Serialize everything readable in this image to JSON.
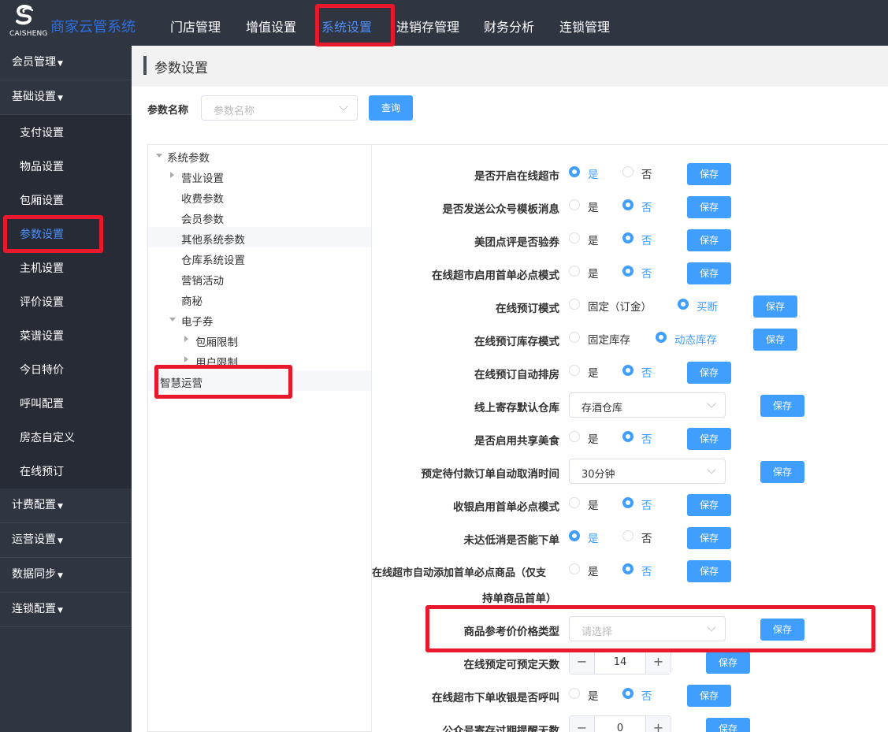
{
  "header": {
    "logo_text": "CAISHENG",
    "brand": "商家云管系统",
    "nav": [
      "门店管理",
      "增值设置",
      "系统设置",
      "进销存管理",
      "财务分析",
      "连锁管理"
    ],
    "active_nav": "系统设置"
  },
  "sidebar": {
    "groups_top": [
      {
        "label": "会员管理"
      },
      {
        "label": "基础设置"
      }
    ],
    "items": [
      "支付设置",
      "物品设置",
      "包厢设置",
      "参数设置",
      "主机设置",
      "评价设置",
      "菜谱设置",
      "今日特价",
      "呼叫配置",
      "房态自定义",
      "在线预订"
    ],
    "active_item": "参数设置",
    "groups_bottom": [
      {
        "label": "计费配置"
      },
      {
        "label": "运营设置"
      },
      {
        "label": "数据同步"
      },
      {
        "label": "连锁配置"
      }
    ]
  },
  "page": {
    "title": "参数设置",
    "filter_label": "参数名称",
    "filter_placeholder": "参数名称",
    "query_button": "查询"
  },
  "tree": {
    "root": "系统参数",
    "nodes": [
      "营业设置",
      "收费参数",
      "会员参数",
      "其他系统参数",
      "仓库系统设置",
      "营销活动",
      "商秘",
      "电子券",
      "包厢限制",
      "用户限制",
      "智慧运营"
    ],
    "selected": "其他系统参数"
  },
  "form": {
    "save_label": "保存",
    "rows": [
      {
        "label": "是否开启在线超市",
        "options": [
          "是",
          "否"
        ],
        "selected": 0
      },
      {
        "label": "是否发送公众号模板消息",
        "options": [
          "是",
          "否"
        ],
        "selected": 1
      },
      {
        "label": "美团点评是否验券",
        "options": [
          "是",
          "否"
        ],
        "selected": 1
      },
      {
        "label": "在线超市启用首单必点模式",
        "options": [
          "是",
          "否"
        ],
        "selected": 1
      },
      {
        "label": "在线预订模式",
        "options": [
          "固定（订金）",
          "买断"
        ],
        "selected": 1
      },
      {
        "label": "在线预订库存模式",
        "options": [
          "固定库存",
          "动态库存"
        ],
        "selected": 1
      },
      {
        "label": "在线预订自动排房",
        "options": [
          "是",
          "否"
        ],
        "selected": 1
      },
      {
        "label": "线上寄存默认仓库",
        "select_value": "存酒仓库"
      },
      {
        "label": "是否启用共享美食",
        "options": [
          "是",
          "否"
        ],
        "selected": 1
      },
      {
        "label": "预定待付款订单自动取消时间",
        "select_value": "30分钟"
      },
      {
        "label": "收银启用首单必点模式",
        "options": [
          "是",
          "否"
        ],
        "selected": 1
      },
      {
        "label": "未达低消是否能下单",
        "options": [
          "是",
          "否"
        ],
        "selected": 0
      },
      {
        "label": "在线超市自动添加首单必点商品（仅支",
        "label_line2": "持单商品首单）",
        "options": [
          "是",
          "否"
        ],
        "selected": 1
      },
      {
        "label": "商品参考价价格类型",
        "select_placeholder": "请选择"
      },
      {
        "label": "在线预定可预定天数",
        "stepper_value": "14"
      },
      {
        "label": "在线超市下单收银是否呼叫",
        "options": [
          "是",
          "否"
        ],
        "selected": 1
      },
      {
        "label": "公众号寄存过期提醒天数",
        "stepper_value": "0"
      }
    ]
  },
  "colors": {
    "topbar_bg": "#2f3541",
    "accent": "#409eff",
    "highlight_box": "#e8192c"
  }
}
